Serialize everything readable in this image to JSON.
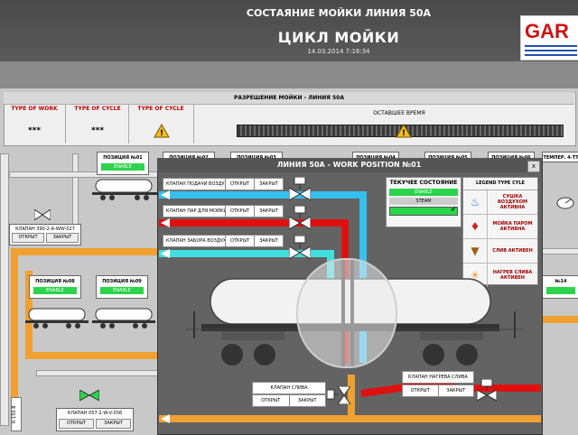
{
  "header": {
    "title": "ЦИКЛ МОЙКИ",
    "datetime": "14.03.2014 7:16:34",
    "logo_text": "GAR",
    "logo_color": "#d01010",
    "logo_stripe_color": "#2050b0"
  },
  "section": {
    "title": "СОСТАЯНИЕ МОЙКИ ЛИНИЯ 50А"
  },
  "permission": {
    "title": "РАЗРЕШЕНИЕ МОЙКИ - ЛИНИЯ 50А",
    "columns": [
      {
        "header": "TYPE OF WORK",
        "value": "***"
      },
      {
        "header": "TYPE OF CYCLE",
        "value": "***"
      },
      {
        "header": "TYPE OF CYCLE",
        "icon": "warning-icon"
      }
    ],
    "remaining_label": "ОСТАВШЕЕ ВРЕМЯ"
  },
  "stations_top": [
    {
      "name": "ПОЗИЦИЯ №01",
      "status": "ENABLE"
    },
    {
      "name": "ПОЗИЦИЯ №02"
    },
    {
      "name": "ПОЗИЦИЯ №03"
    },
    {
      "name": "ПОЗИЦИЯ №04"
    },
    {
      "name": "ПОЗИЦИЯ №05"
    },
    {
      "name": "ПОЗИЦИЯ №06"
    },
    {
      "name": "ТЕМПЕР. 4-ТТ"
    }
  ],
  "stations_mid": [
    {
      "name": "ПОЗИЦИЯ №08",
      "status": "ENABLE"
    },
    {
      "name": "ПОЗИЦИЯ №09",
      "status": "ENABLE"
    }
  ],
  "station_14": {
    "name": "№14"
  },
  "bg_valves": [
    {
      "name": "КЛАПАН 390-2-А-WW-027",
      "open": "ОТКРЫТ",
      "close": "ЗАКРЫТ"
    },
    {
      "name": "КЛАПАН 057-2-W-V-036",
      "open": "ОТКРЫТ",
      "close": "ЗАКРЫТ"
    }
  ],
  "side_tag": "К 150 В",
  "dialog": {
    "title": "ЛИНИЯ 50А - WORK POSITION №01",
    "close": "x",
    "controls": [
      {
        "label": "КЛАПАН ПОДАЧИ ВОЗДУХА",
        "open": "ОТКРЫТ",
        "close": "ЗАКРЫТ"
      },
      {
        "label": "КЛАПАН ПАР ДЛЯ МОЙКИ",
        "open": "ОТКРЫТ",
        "close": "ЗАКРЫТ"
      },
      {
        "label": "КЛАПАН ЗАБОРА ВОЗДУХА",
        "open": "ОТКРЫТ",
        "close": "ЗАКРЫТ"
      }
    ],
    "heat_valve": {
      "label": "КЛАПАН НАГРЕВА СЛИВА",
      "open": "ОТКРЫТ",
      "close": "ЗАКРЫТ"
    },
    "drain_valve": {
      "label": "КЛАПАН СЛИВА",
      "open": "ОТКРЫТ",
      "close": "ЗАКРЫТ"
    },
    "state": {
      "title": "ТЕКУЧЕЕ СОСТОЯНИЕ",
      "enable": "ENABLE",
      "steam": "STEAM"
    },
    "legend": {
      "title": "LEGEND TYPE CYLE",
      "items": [
        {
          "icon": "air-drying-icon",
          "text": "СУШКА ВОЗДУХОМ АКТИВНА"
        },
        {
          "icon": "steam-wash-icon",
          "text": "МОЙКА ПАРОМ АКТИВНА"
        },
        {
          "icon": "drain-icon",
          "text": "СЛИВ АКТИВЕН"
        },
        {
          "icon": "heating-icon",
          "text": "НАГРЕВ СЛИВА АКТИВЕН"
        }
      ]
    }
  },
  "colors": {
    "enable_green": "#2bd44b",
    "pipe_orange": "#f0a030",
    "pipe_blue": "#35c0f0",
    "pipe_red": "#e01010",
    "pipe_cyan": "#40e0e0",
    "label_red": "#c00000"
  }
}
